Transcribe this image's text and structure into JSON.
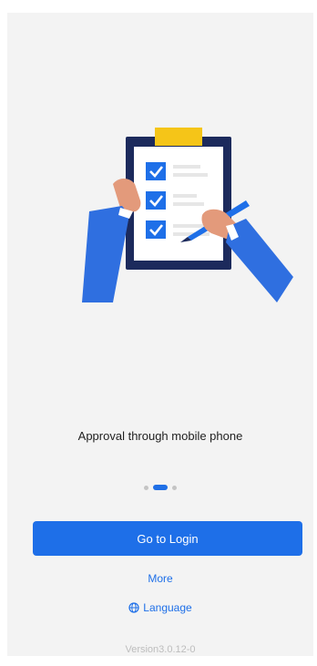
{
  "onboarding": {
    "caption": "Approval through mobile phone",
    "pager": {
      "total": 3,
      "active_index": 1
    }
  },
  "actions": {
    "login_label": "Go to Login",
    "more_label": "More",
    "language_label": "Language",
    "language_icon": "globe-icon"
  },
  "footer": {
    "version": "Version3.0.12-0"
  },
  "colors": {
    "primary": "#1e6fe8",
    "background": "#f3f3f3",
    "clipboard_frame": "#1c2a5c",
    "clip": "#f5c518",
    "sleeve": "#2f6fe0",
    "skin": "#e39a7b"
  }
}
